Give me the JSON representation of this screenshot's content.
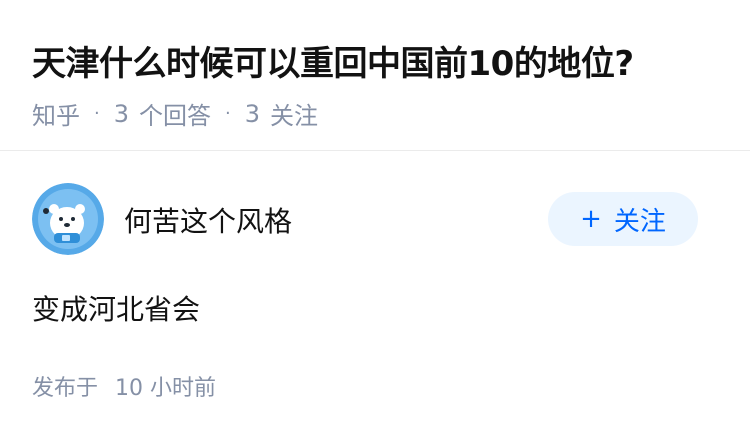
{
  "question": {
    "title": "天津什么时候可以重回中国前10的地位?",
    "source": "知乎",
    "answer_count": "3",
    "answer_label": "个回答",
    "follow_count": "3",
    "follow_label": "关注",
    "separator": "·"
  },
  "answer": {
    "author_name": "何苦这个风格",
    "avatar_icon": "polar-bear-avatar-icon",
    "follow_button_plus": "+",
    "follow_button_label": "关注",
    "content": "变成河北省会",
    "publish_label": "发布于",
    "publish_time": "10 小时前"
  },
  "colors": {
    "title": "#121212",
    "meta": "#8590a6",
    "accent": "#0066ff",
    "accent_bg": "#ebf5ff",
    "divider": "#ebebeb"
  }
}
